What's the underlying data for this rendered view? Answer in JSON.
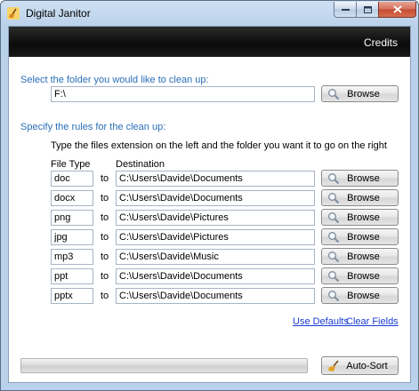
{
  "window": {
    "title": "Digital Janitor"
  },
  "header": {
    "credits_label": "Credits"
  },
  "folder_section": {
    "label": "Select the folder you would like to clean up:",
    "path_value": "F:\\",
    "browse_label": "Browse"
  },
  "rules_section": {
    "label": "Specify the rules for the clean up:",
    "instructions": "Type the files extension on the left and the folder you want it to go on the right",
    "col_file_type": "File Type",
    "col_destination": "Destination",
    "to_label": "to",
    "browse_label": "Browse",
    "rules": [
      {
        "ext": "doc",
        "dest": "C:\\Users\\Davide\\Documents"
      },
      {
        "ext": "docx",
        "dest": "C:\\Users\\Davide\\Documents"
      },
      {
        "ext": "png",
        "dest": "C:\\Users\\Davide\\Pictures"
      },
      {
        "ext": "jpg",
        "dest": "C:\\Users\\Davide\\Pictures"
      },
      {
        "ext": "mp3",
        "dest": "C:\\Users\\Davide\\Music"
      },
      {
        "ext": "ppt",
        "dest": "C:\\Users\\Davide\\Documents"
      },
      {
        "ext": "pptx",
        "dest": "C:\\Users\\Davide\\Documents"
      }
    ]
  },
  "links": {
    "use_defaults": "Use Defaults",
    "clear_fields": "Clear Fields"
  },
  "footer": {
    "progress": 0,
    "autosort_label": "Auto-Sort"
  },
  "colors": {
    "section_label": "#2a6fb8",
    "link": "#1a3bd6",
    "header_band": "#111111"
  },
  "icons": {
    "app": "broom-icon",
    "browse": "magnifier-icon",
    "autosort": "broom-icon"
  }
}
